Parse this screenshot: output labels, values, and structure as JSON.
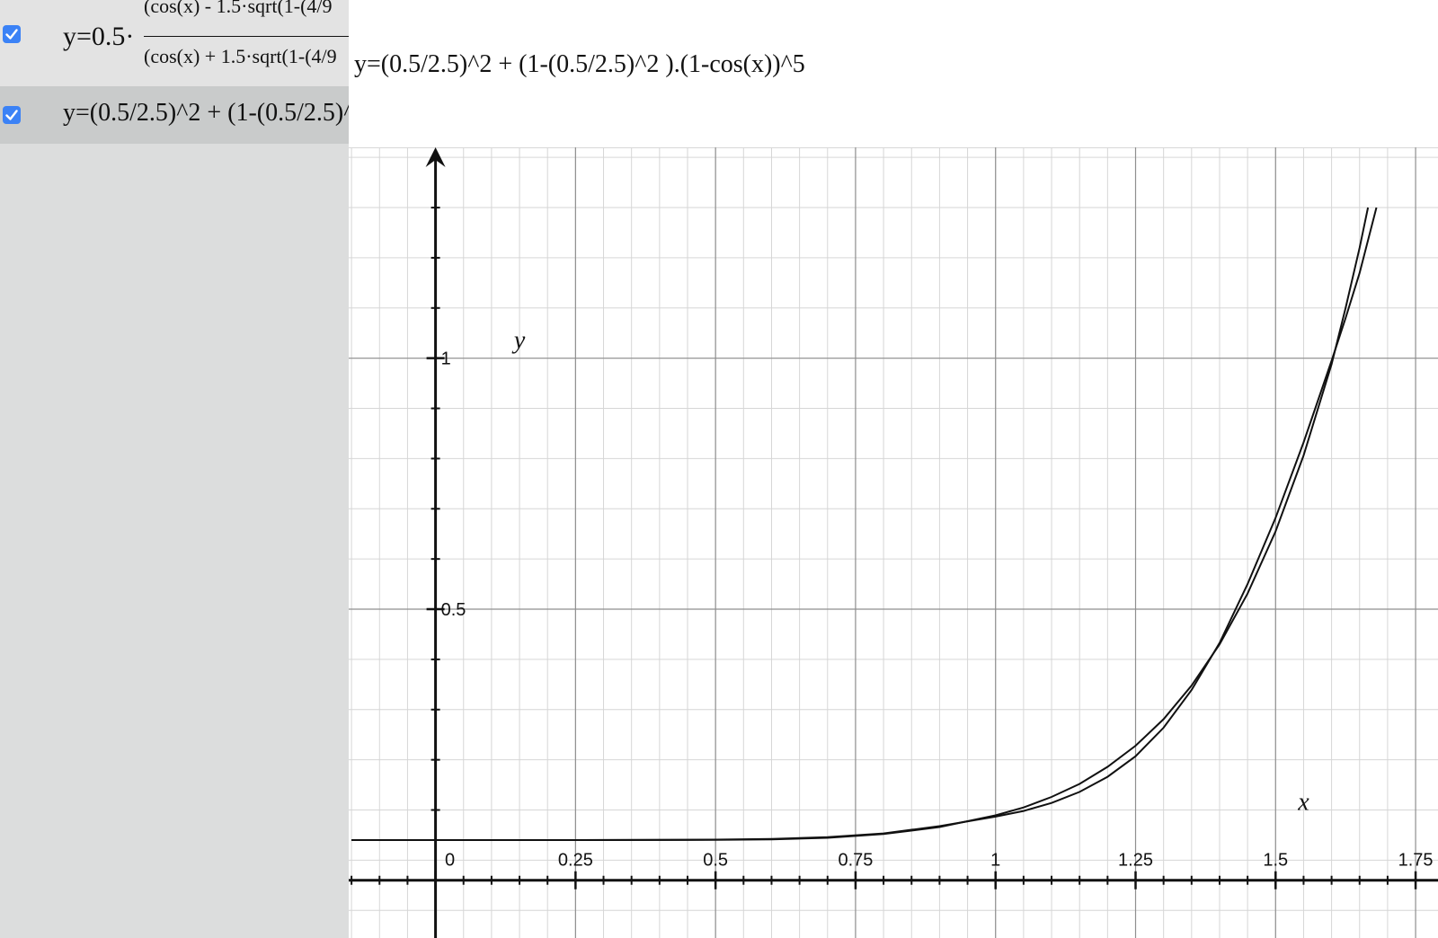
{
  "expressions": [
    {
      "checked": true,
      "prefix": "y=0.5·",
      "numerator": "(cos(x) - 1.5·sqrt(1-(4/9",
      "denominator": "(cos(x) + 1.5·sqrt(1-(4/9"
    },
    {
      "checked": true,
      "text": "y=(0.5/2.5)^2 + (1-(0.5/2.5)^2 ).(1",
      "full_text": "y=(0.5/2.5)^2 + (1-(0.5/2.5)^2 ).(1-cos(x))^5"
    }
  ],
  "colors": {
    "checkbox": "#3b82f6",
    "sidebar_bg": "#dcdddd",
    "row_selected": "#c9cbcb",
    "curve": "#111111",
    "grid_major": "#8f8f8f",
    "grid_minor": "#d6d6d6"
  },
  "icons": {
    "checkbox": "checkmark-icon"
  },
  "chart_data": {
    "type": "line",
    "xlabel": "x",
    "ylabel": "y",
    "xlim": [
      -0.155,
      1.79
    ],
    "ylim": [
      -0.155,
      1.42
    ],
    "x_ticks": [
      {
        "value": 0,
        "label": "0"
      },
      {
        "value": 0.25,
        "label": "0.25"
      },
      {
        "value": 0.5,
        "label": "0.5"
      },
      {
        "value": 0.75,
        "label": "0.75"
      },
      {
        "value": 1,
        "label": "1"
      },
      {
        "value": 1.25,
        "label": "1.25"
      },
      {
        "value": 1.5,
        "label": "1.5"
      },
      {
        "value": 1.75,
        "label": "1.75"
      }
    ],
    "y_ticks": [
      {
        "value": 0.5,
        "label": "0.5"
      },
      {
        "value": 1,
        "label": "1"
      }
    ],
    "grid": true,
    "series": [
      {
        "x": [
          -0.15,
          0,
          0.25,
          0.5,
          0.6,
          0.7,
          0.8,
          0.9,
          1.0,
          1.05,
          1.1,
          1.15,
          1.2,
          1.25,
          1.3,
          1.35,
          1.4,
          1.45,
          1.5,
          1.55,
          1.6,
          1.625,
          1.65,
          1.665
        ],
        "y": [
          0.04,
          0.04,
          0.04,
          0.0404,
          0.0415,
          0.0446,
          0.052,
          0.066,
          0.0893,
          0.105,
          0.126,
          0.152,
          0.186,
          0.228,
          0.281,
          0.348,
          0.43,
          0.531,
          0.655,
          0.806,
          0.988,
          1.1,
          1.22,
          1.3
        ]
      },
      {
        "x": [
          -0.15,
          0,
          0.25,
          0.5,
          0.6,
          0.7,
          0.8,
          0.9,
          1.0,
          1.05,
          1.1,
          1.15,
          1.2,
          1.25,
          1.3,
          1.35,
          1.4,
          1.45,
          1.5,
          1.55,
          1.6,
          1.625,
          1.65,
          1.68
        ],
        "y": [
          0.04,
          0.04,
          0.04,
          0.0409,
          0.0424,
          0.0458,
          0.0534,
          0.0678,
          0.0868,
          0.098,
          0.114,
          0.136,
          0.166,
          0.207,
          0.264,
          0.339,
          0.433,
          0.55,
          0.682,
          0.832,
          0.995,
          1.08,
          1.17,
          1.3
        ]
      }
    ]
  }
}
